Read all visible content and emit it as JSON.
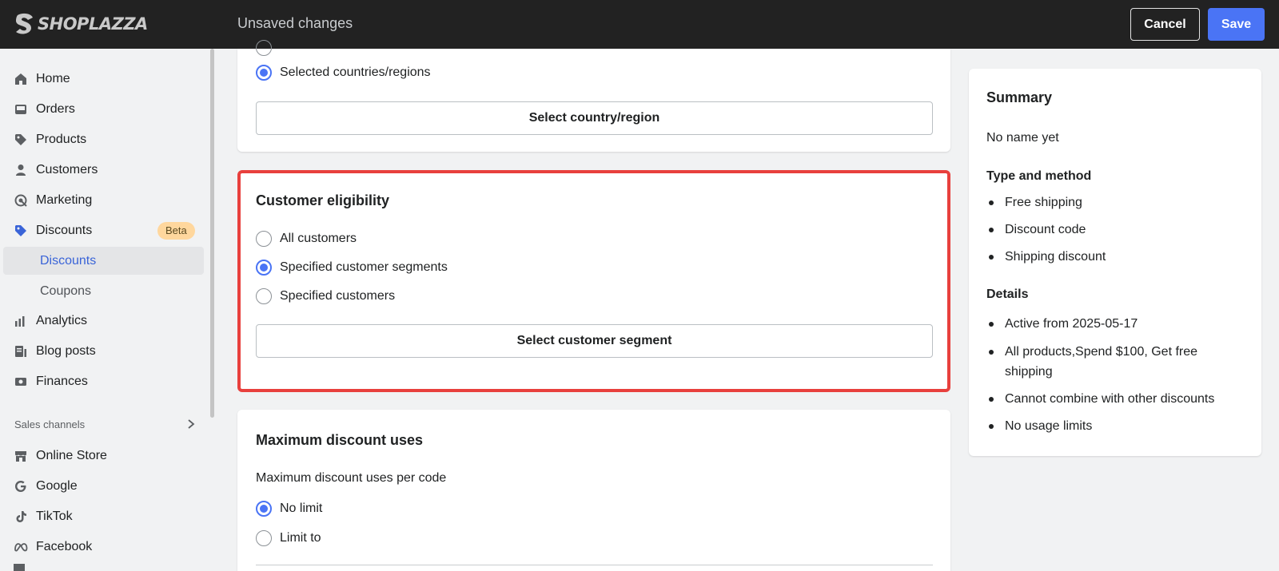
{
  "topbar": {
    "brand": "SHOPLAZZA",
    "status": "Unsaved changes",
    "cancel_label": "Cancel",
    "save_label": "Save"
  },
  "sidebar": {
    "items": [
      {
        "label": "Home",
        "icon": "home-icon"
      },
      {
        "label": "Orders",
        "icon": "inbox-icon"
      },
      {
        "label": "Products",
        "icon": "tag-icon"
      },
      {
        "label": "Customers",
        "icon": "person-icon"
      },
      {
        "label": "Marketing",
        "icon": "target-icon"
      },
      {
        "label": "Discounts",
        "icon": "discount-tag-icon",
        "badge": "Beta"
      },
      {
        "label": "Discounts",
        "sub": true,
        "active": true
      },
      {
        "label": "Coupons",
        "sub": true
      },
      {
        "label": "Analytics",
        "icon": "bar-chart-icon"
      },
      {
        "label": "Blog posts",
        "icon": "blog-icon"
      },
      {
        "label": "Finances",
        "icon": "finance-icon"
      }
    ],
    "section_label": "Sales channels",
    "channels": [
      {
        "label": "Online Store",
        "icon": "store-icon"
      },
      {
        "label": "Google",
        "icon": "google-icon"
      },
      {
        "label": "TikTok",
        "icon": "tiktok-icon"
      },
      {
        "label": "Facebook",
        "icon": "meta-icon"
      }
    ]
  },
  "countries_card": {
    "option_selected": "Selected countries/regions",
    "button": "Select country/region"
  },
  "eligibility": {
    "title": "Customer eligibility",
    "options": [
      "All customers",
      "Specified customer segments",
      "Specified customers"
    ],
    "selected_index": 1,
    "button": "Select customer segment"
  },
  "max_uses": {
    "title": "Maximum discount uses",
    "subtitle": "Maximum discount uses per code",
    "options": [
      "No limit",
      "Limit to"
    ],
    "selected_index": 0
  },
  "summary": {
    "title": "Summary",
    "name": "No name yet",
    "type_heading": "Type and method",
    "type_items": [
      "Free shipping",
      "Discount code",
      "Shipping discount"
    ],
    "details_heading": "Details",
    "details_items": [
      "Active from 2025-05-17",
      "All products,Spend $100, Get free shipping",
      "Cannot combine with other discounts",
      "No usage limits"
    ]
  },
  "colors": {
    "accent": "#4a74f5",
    "highlight": "#e8403d",
    "topbar": "#222222"
  }
}
